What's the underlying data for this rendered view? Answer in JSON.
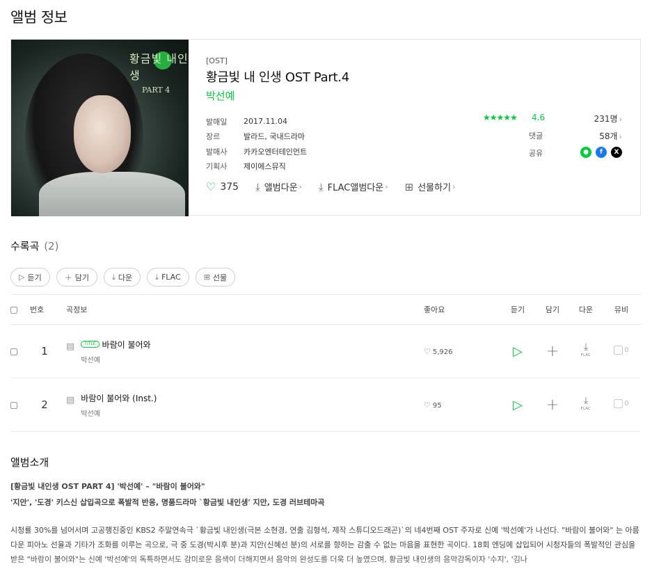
{
  "page": {
    "title": "앨범 정보"
  },
  "album": {
    "category": "[OST]",
    "title": "황금빛 내 인생 OST Part.4",
    "artist": "박선예",
    "cover": {
      "art_title": "황금빛 내인생",
      "art_part": "PART 4"
    },
    "meta": [
      {
        "key": "발매일",
        "value": "2017.11.04"
      },
      {
        "key": "장르",
        "value": "발라드, 국내드라마"
      },
      {
        "key": "발매사",
        "value": "카카오엔터테인먼트"
      },
      {
        "key": "기획사",
        "value": "제이에스뮤직"
      }
    ],
    "rating": {
      "stars": 4.5,
      "value": "4.6",
      "count": "231명"
    },
    "comments": {
      "label": "댓글",
      "count": "58개"
    },
    "share": {
      "label": "공유",
      "icons": [
        "kakaostory-icon",
        "facebook-icon",
        "x-icon"
      ]
    },
    "actions": {
      "likes": "375",
      "album_download": "앨범다운",
      "flac_download": "FLAC앨범다운",
      "gift": "선물하기"
    }
  },
  "tracks": {
    "heading": "수록곡",
    "count": "(2)",
    "buttons": [
      "듣기",
      "담기",
      "다운",
      "FLAC",
      "선물"
    ],
    "columns": {
      "no": "번호",
      "info": "곡정보",
      "likes": "좋아요",
      "play": "듣기",
      "add": "담기",
      "down": "다운",
      "mv": "뮤비"
    },
    "rows": [
      {
        "no": "1",
        "badge": "TITLE",
        "title": "바람이 불어와",
        "artist": "박선예",
        "likes": "5,926",
        "flac": "FLAC",
        "mv": "0"
      },
      {
        "no": "2",
        "badge": "",
        "title": "바람이 불어와 (Inst.)",
        "artist": "박선예",
        "likes": "95",
        "flac": "FLAC",
        "mv": "0"
      }
    ]
  },
  "intro": {
    "heading": "앨범소개",
    "line1": "[황금빛 내인생 OST PART 4] '박선예' – \"바람이 불어와\"",
    "line2": "'지안', '도경' 키스신 삽입곡으로 폭발적 반응, 명품드라마 `황금빛 내인생' 지안, 도경 러브테마곡",
    "body": "시청률 30%를 넘어서며 고공행진중인 KBS2 주말연속극 `황금빛 내인생(극본 소현경, 연출 김형석, 제작 스튜디오드래곤)`의 네4번째 OST 주자로 신예 '박선예'가 나선다. \"바람이 불어와\" 는 아름다운 피아노 선율과 기타가 조화를 이루는 곡으로, 극 중 도경(박시후 분)과 지안(신혜선 분)의 서로를 향하는 감출 수 없는 마음을 표현한 곡이다. 18회 엔딩에 삽입되어 시청자들의 폭발적인 관심을 받은 \"바람이 불어와\"는 신예 '박선예'의 독특하면서도 감미로운 음색이 더해지면서 음악의 완성도를 더욱 더 높였으며, 황금빛 내인생의 음악감독이자 '수지', '김나"
  },
  "colors": {
    "accent": "#00cd3c",
    "facebook": "#1877f2",
    "x": "#000000"
  }
}
